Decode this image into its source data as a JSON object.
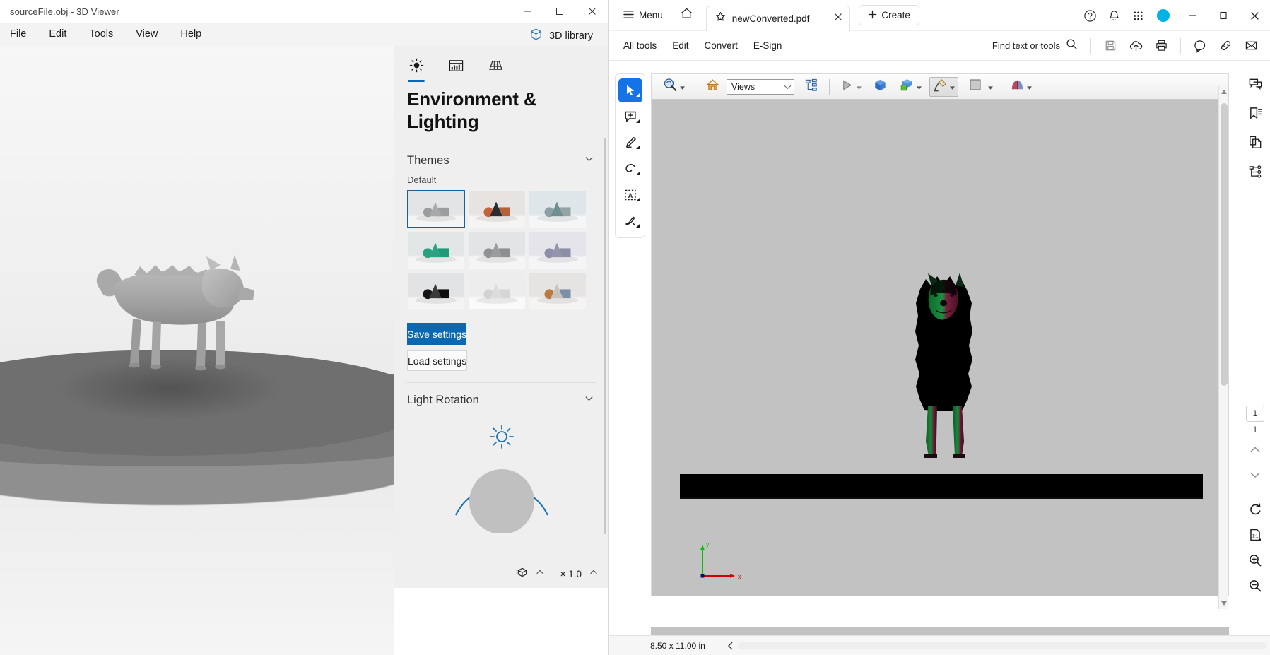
{
  "viewer": {
    "title": "sourceFile.obj - 3D Viewer",
    "window_controls": [
      {
        "name": "minimize",
        "glyph": "minimize-icon"
      },
      {
        "name": "maximize",
        "glyph": "maximize-icon"
      },
      {
        "name": "close",
        "glyph": "close-icon"
      }
    ],
    "menus": [
      "File",
      "Edit",
      "Tools",
      "View",
      "Help"
    ],
    "library_button": "3D library",
    "pane": {
      "tabs": [
        {
          "name": "environment-lighting",
          "icon": "sun-icon",
          "active": true
        },
        {
          "name": "visual-settings",
          "icon": "histogram-icon",
          "active": false
        },
        {
          "name": "grid-settings",
          "icon": "grid-icon",
          "active": false
        }
      ],
      "heading": "Environment & Lighting",
      "themes": {
        "title": "Themes",
        "sub_label": "Default",
        "cells": [
          {
            "name": "theme-default-gray",
            "selected": true,
            "bg_top": "#e2e4e6",
            "bg_bot": "#f4f4f4",
            "sphere": "#9a9d9f",
            "cone": "#a7a9ab",
            "cube": "#9b9d9f"
          },
          {
            "name": "theme-sunset",
            "selected": false,
            "bg_top": "#e7e3e1",
            "bg_bot": "#f6f4f3",
            "sphere": "#c4623a",
            "cone": "#2b2b33",
            "cube": "#b5613c"
          },
          {
            "name": "theme-sky",
            "selected": false,
            "bg_top": "#dfe6ea",
            "bg_bot": "#f4f6f7",
            "sphere": "#8a9fa6",
            "cone": "#6f8f91",
            "cube": "#94a3a6"
          },
          {
            "name": "theme-teal",
            "selected": false,
            "bg_top": "#e3e6e6",
            "bg_bot": "#f5f5f5",
            "sphere": "#27a07f",
            "cone": "#2aa383",
            "cube": "#1f9a78"
          },
          {
            "name": "theme-neutral",
            "selected": false,
            "bg_top": "#e3e4e6",
            "bg_bot": "#f5f5f5",
            "sphere": "#8f9294",
            "cone": "#9a9c9e",
            "cube": "#8d9092"
          },
          {
            "name": "theme-lavender",
            "selected": false,
            "bg_top": "#e4e4ea",
            "bg_bot": "#f5f5f7",
            "sphere": "#8d8fa8",
            "cone": "#9295ac",
            "cube": "#8c8ea6"
          },
          {
            "name": "theme-dark",
            "selected": false,
            "bg_top": "#e2e3e5",
            "bg_bot": "#f4f4f4",
            "sphere": "#141414",
            "cone": "#3a3a3a",
            "cube": "#0d0d0d"
          },
          {
            "name": "theme-white",
            "selected": false,
            "bg_top": "#ededed",
            "bg_bot": "#fafafa",
            "sphere": "#d2d2d2",
            "cone": "#dcdcdc",
            "cube": "#d6d6d6"
          },
          {
            "name": "theme-colorful",
            "selected": false,
            "bg_top": "#e6e4e2",
            "bg_bot": "#f5f4f3",
            "sphere": "#b97a45",
            "cone": "#c9c3bd",
            "cube": "#7b8fa8"
          }
        ]
      },
      "save_settings": "Save settings",
      "load_settings": "Load settings",
      "light_rotation": {
        "title": "Light Rotation",
        "sun_icon": "sun-icon",
        "dial_color": "#1a72b8",
        "knob_color": "#c0c0c0"
      }
    },
    "statusbar": {
      "model_icon": "model-info-icon",
      "zoom_label": "× 1.0",
      "up_caret": "chevron-up-icon"
    }
  },
  "acrobat": {
    "menu_label": "Menu",
    "home_icon": "home-icon",
    "tab": {
      "star_icon": "star-icon",
      "name": "newConverted.pdf",
      "close_icon": "close-icon"
    },
    "create_button": "Create",
    "title_right_icons": [
      {
        "name": "help-icon"
      },
      {
        "name": "bell-icon"
      },
      {
        "name": "apps-grid-icon"
      }
    ],
    "window_controls": [
      {
        "name": "minimize",
        "glyph": "minimize-icon"
      },
      {
        "name": "restore",
        "glyph": "restore-icon"
      },
      {
        "name": "close",
        "glyph": "close-icon"
      }
    ],
    "toolbar_links": [
      "All tools",
      "Edit",
      "Convert",
      "E-Sign"
    ],
    "find": {
      "label": "Find text or tools",
      "icon": "search-icon"
    },
    "toolbar_right_icons": [
      {
        "name": "save-icon"
      },
      {
        "name": "upload-cloud-icon"
      },
      {
        "name": "print-icon"
      },
      {
        "name": "add-comment-icon"
      },
      {
        "name": "link-icon"
      },
      {
        "name": "email-icon"
      }
    ],
    "left_rail": [
      {
        "name": "select-tool",
        "icon": "cursor-icon",
        "active": true,
        "has_caret": true
      },
      {
        "name": "comment-tool",
        "icon": "add-comment-icon",
        "active": false,
        "has_caret": true
      },
      {
        "name": "highlight-tool",
        "icon": "highlighter-icon",
        "active": false,
        "has_caret": true
      },
      {
        "name": "draw-tool",
        "icon": "lasso-icon",
        "active": false,
        "has_caret": true
      },
      {
        "name": "text-select-tool",
        "icon": "text-box-icon",
        "active": false,
        "has_caret": true
      },
      {
        "name": "sign-tool",
        "icon": "signature-icon",
        "active": false,
        "has_caret": true
      }
    ],
    "pdf_3d_toolbar": {
      "rotate_tool": {
        "name": "3d-rotate-tool",
        "icon": "rotate-magnifier-icon",
        "has_caret": true
      },
      "home_view": {
        "name": "default-view",
        "icon": "home-icon"
      },
      "views_select": {
        "name": "views-dropdown",
        "value": "Views"
      },
      "model_tree": {
        "name": "model-tree-toggle",
        "icon": "tree-icon"
      },
      "play": {
        "name": "play-animation",
        "icon": "play-icon",
        "has_caret": true
      },
      "use_ortho": {
        "name": "orthographic-toggle",
        "icon": "blue-cube-icon"
      },
      "model_render": {
        "name": "model-render-mode",
        "icon": "green-cube-icon",
        "has_caret": true
      },
      "lighting": {
        "name": "lighting-mode",
        "icon": "lamp-icon",
        "has_caret": true,
        "pressed": true
      },
      "background": {
        "name": "background-color",
        "icon": "swatch-icon",
        "has_caret": true
      },
      "cross_section": {
        "name": "cross-section",
        "icon": "cross-section-icon",
        "has_caret": true
      }
    },
    "right_rail": [
      {
        "name": "comments-panel",
        "icon": "comment-icon"
      },
      {
        "name": "bookmarks-panel",
        "icon": "bookmark-icon"
      },
      {
        "name": "page-thumbnails-panel",
        "icon": "pages-icon"
      },
      {
        "name": "model-tree-panel",
        "icon": "tree-icon"
      }
    ],
    "page_nav": {
      "current_page": "1",
      "total_pages": "1",
      "prev_icon": "chevron-up-icon",
      "next_icon": "chevron-down-icon"
    },
    "right_bottom_tools": [
      {
        "name": "rotate-view",
        "icon": "rotate-cw-icon"
      },
      {
        "name": "actual-size",
        "icon": "fit-1-1-icon",
        "has_caret": true
      },
      {
        "name": "zoom-in",
        "icon": "zoom-in-icon"
      },
      {
        "name": "zoom-out",
        "icon": "zoom-out-icon"
      }
    ],
    "statusbar": {
      "page_size": "8.50 x 11.00 in",
      "collapse_icon": "chevron-left-icon"
    },
    "model_view": {
      "axis_labels": {
        "y": "y",
        "x": "x"
      },
      "axis_y_color": "#00c000",
      "axis_x_color": "#d00000",
      "background_color": "#c2c2c2",
      "ground_color": "#000000"
    }
  }
}
